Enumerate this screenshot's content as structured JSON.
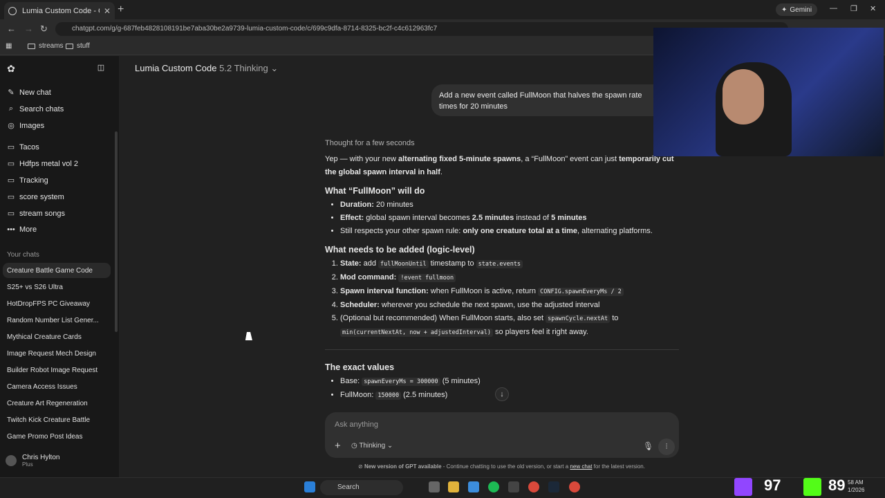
{
  "browser": {
    "tab_title": "Lumia Custom Code - Creature",
    "gemini_label": "Gemini",
    "url": "chatgpt.com/g/g-687feb4828108191be7aba30be2a9739-lumia-custom-code/c/699c9dfa-8714-8325-bc2f-c4c612963fc7",
    "bookmarks": [
      "streams",
      "stuff"
    ]
  },
  "sidebar": {
    "top_items": [
      {
        "label": "New chat",
        "icon": "new-chat-icon"
      },
      {
        "label": "Search chats",
        "icon": "search-icon"
      },
      {
        "label": "Images",
        "icon": "image-icon"
      }
    ],
    "projects": [
      "Tacos",
      "Hdfps metal vol 2",
      "Tracking",
      "score system",
      "stream songs"
    ],
    "more_label": "More",
    "your_chats_label": "Your chats",
    "chats": [
      "Creature Battle Game Code",
      "S25+ vs S26 Ultra",
      "HotDropFPS PC Giveaway",
      "Random Number List Gener...",
      "Mythical Creature Cards",
      "Image Request Mech Design",
      "Builder Robot Image Request",
      "Camera Access Issues",
      "Creature Art Regeneration",
      "Twitch Kick Creature Battle",
      "Game Promo Post Ideas"
    ],
    "user_name": "Chris Hylton",
    "user_plan": "Plus"
  },
  "header": {
    "gpt_name": "Lumia Custom Code",
    "model": "5.2 Thinking"
  },
  "conversation": {
    "user_message": "Add a new event called FullMoon that halves the spawn rate times for 20 minutes",
    "thought": "Thought for a few seconds",
    "intro_pre": "Yep — with your new ",
    "intro_b1": "alternating fixed 5-minute spawns",
    "intro_mid": ", a “FullMoon” event can just ",
    "intro_b2": "temporarily cut the global spawn interval in half",
    "intro_end": ".",
    "h1": "What “FullMoon” will do",
    "do_items": [
      {
        "b": "Duration:",
        "t": " 20 minutes"
      },
      {
        "b": "Effect:",
        "t": " global spawn interval becomes ",
        "b2": "2.5 minutes",
        "t2": " instead of ",
        "b3": "5 minutes"
      },
      {
        "t": "Still respects your other spawn rule: ",
        "b": "only one creature total at a time",
        "t2": ", alternating platforms."
      }
    ],
    "h2": "What needs to be added (logic-level)",
    "steps": [
      {
        "b": "State:",
        "t": " add ",
        "c": "fullMoonUntil",
        "t2": " timestamp to ",
        "c2": "state.events"
      },
      {
        "b": "Mod command:",
        "t": " ",
        "c": "!event fullmoon"
      },
      {
        "b": "Spawn interval function:",
        "t": " when FullMoon is active, return ",
        "c": "CONFIG.spawnEveryMs / 2"
      },
      {
        "b": "Scheduler:",
        "t": " wherever you schedule the next spawn, use the adjusted interval"
      },
      {
        "t": "(Optional but recommended) When FullMoon starts, also set ",
        "c": "spawnCycle.nextAt",
        "t2": " to ",
        "c2": "min(currentNextAt, now + adjustedInterval)",
        "t3": " so players feel it right away."
      }
    ],
    "h3": "The exact values",
    "values": [
      {
        "t": "Base: ",
        "c": "spawnEveryMs = 300000",
        "t2": " (5 minutes)"
      },
      {
        "t": "FullMoon: ",
        "c": "150000",
        "t2": " (2.5 minutes)"
      }
    ]
  },
  "composer": {
    "placeholder": "Ask anything",
    "mode": "Thinking"
  },
  "notice": {
    "bold": "New version of GPT available",
    "text": " - Continue chatting to use the old version, or start a ",
    "link": "new chat",
    "end": " for the latest version."
  },
  "taskbar": {
    "search_label": "Search",
    "score_left": "97",
    "score_right": "89",
    "clock": "58 AM",
    "date": "1/2026"
  }
}
